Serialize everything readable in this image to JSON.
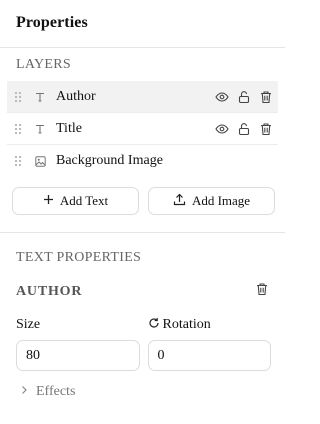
{
  "panel": {
    "title": "Properties"
  },
  "layers": {
    "section_label": "LAYERS",
    "items": [
      {
        "name": "Author",
        "type_icon": "text-type-icon",
        "selected": true,
        "show_actions": true
      },
      {
        "name": "Title",
        "type_icon": "text-type-icon",
        "selected": false,
        "show_actions": true
      },
      {
        "name": "Background Image",
        "type_icon": "image-type-icon",
        "selected": false,
        "show_actions": false
      }
    ]
  },
  "actions": {
    "add_text_label": "Add Text",
    "add_image_label": "Add Image"
  },
  "text_properties": {
    "section_label": "TEXT PROPERTIES",
    "selected_layer": "AUTHOR",
    "size": {
      "label": "Size",
      "value": "80"
    },
    "rotation": {
      "label": "Rotation",
      "value": "0"
    },
    "effects_label": "Effects"
  }
}
